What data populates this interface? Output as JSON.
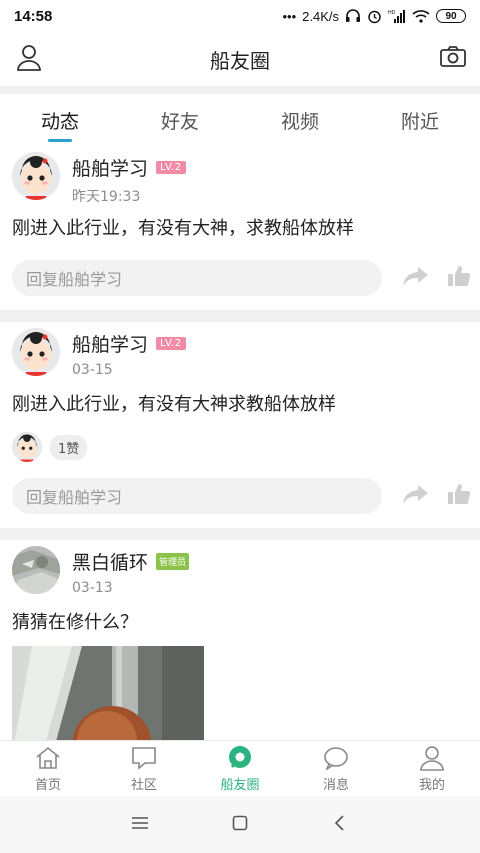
{
  "status_bar": {
    "time": "14:58",
    "net_speed": "2.4K/s",
    "battery": "90",
    "hd_label": "HD"
  },
  "header": {
    "title": "船友圈",
    "left_icon": "profile-icon",
    "right_icon": "camera-icon"
  },
  "tabs": [
    {
      "label": "动态",
      "active": true
    },
    {
      "label": "好友",
      "active": false
    },
    {
      "label": "视频",
      "active": false
    },
    {
      "label": "附近",
      "active": false
    }
  ],
  "posts": [
    {
      "author": "船舶学习",
      "level": "LV.2",
      "time": "昨天19:33",
      "content": "刚进入此行业，有没有大神，求教船体放样",
      "reply_placeholder": "回复船舶学习"
    },
    {
      "author": "船舶学习",
      "level": "LV.2",
      "time": "03-15",
      "content": "刚进入此行业，有没有大神求教船体放样",
      "like_count": "1赞",
      "reply_placeholder": "回复船舶学习"
    },
    {
      "author": "黑白循环",
      "badge": "管理员",
      "time": "03-13",
      "content": "猜猜在修什么？"
    }
  ],
  "bottom_nav": [
    {
      "label": "首页",
      "icon": "home-icon",
      "active": false
    },
    {
      "label": "社区",
      "icon": "chat-square-icon",
      "active": false
    },
    {
      "label": "船友圈",
      "icon": "circle-message-icon",
      "active": true
    },
    {
      "label": "消息",
      "icon": "message-bubble-icon",
      "active": false
    },
    {
      "label": "我的",
      "icon": "user-icon",
      "active": false
    }
  ],
  "colors": {
    "accent_tab": "#2a9fd6",
    "accent_nav": "#2bb37f",
    "level_badge": "#f08aa5",
    "admin_badge": "#8bc34a"
  }
}
